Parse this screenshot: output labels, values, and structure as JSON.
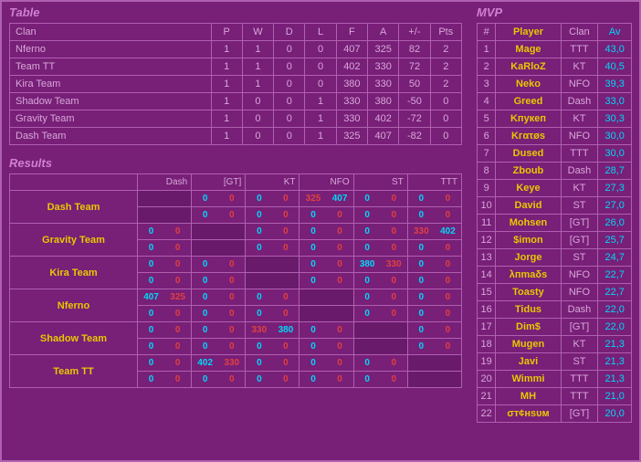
{
  "titles": {
    "table": "Table",
    "results": "Results",
    "mvp": "MVP"
  },
  "standings": {
    "headers": [
      "Clan",
      "P",
      "W",
      "D",
      "L",
      "F",
      "A",
      "+/-",
      "Pts"
    ],
    "rows": [
      {
        "clan": "Nferno",
        "p": 1,
        "w": 1,
        "d": 0,
        "l": 0,
        "f": 407,
        "a": 325,
        "diff": "82",
        "pts": 2
      },
      {
        "clan": "Team TT",
        "p": 1,
        "w": 1,
        "d": 0,
        "l": 0,
        "f": 402,
        "a": 330,
        "diff": "72",
        "pts": 2
      },
      {
        "clan": "Kira Team",
        "p": 1,
        "w": 1,
        "d": 0,
        "l": 0,
        "f": 380,
        "a": 330,
        "diff": "50",
        "pts": 2
      },
      {
        "clan": "Shadow Team",
        "p": 1,
        "w": 0,
        "d": 0,
        "l": 1,
        "f": 330,
        "a": 380,
        "diff": "-50",
        "pts": 0
      },
      {
        "clan": "Gravity Team",
        "p": 1,
        "w": 0,
        "d": 0,
        "l": 1,
        "f": 330,
        "a": 402,
        "diff": "-72",
        "pts": 0
      },
      {
        "clan": "Dash Team",
        "p": 1,
        "w": 0,
        "d": 0,
        "l": 1,
        "f": 325,
        "a": 407,
        "diff": "-82",
        "pts": 0
      }
    ]
  },
  "results": {
    "col_headers": [
      "Dash",
      "[GT]",
      "KT",
      "NFO",
      "ST",
      "TTT"
    ],
    "teams": [
      "Dash Team",
      "Gravity Team",
      "Kira Team",
      "Nferno",
      "Shadow Team",
      "Team TT"
    ],
    "matrix": [
      [
        null,
        [
          "0",
          "0"
        ],
        [
          "0",
          "0"
        ],
        [
          "325",
          "407"
        ],
        [
          "0",
          "0"
        ],
        [
          "0",
          "0"
        ]
      ],
      [
        [
          "0",
          "0"
        ],
        null,
        [
          "0",
          "0"
        ],
        [
          "0",
          "0"
        ],
        [
          "0",
          "0"
        ],
        [
          "330",
          "402"
        ]
      ],
      [
        [
          "0",
          "0"
        ],
        [
          "0",
          "0"
        ],
        null,
        [
          "0",
          "0"
        ],
        [
          "380",
          "330"
        ],
        [
          "0",
          "0"
        ]
      ],
      [
        [
          "407",
          "325"
        ],
        [
          "0",
          "0"
        ],
        [
          "0",
          "0"
        ],
        null,
        [
          "0",
          "0"
        ],
        [
          "0",
          "0"
        ]
      ],
      [
        [
          "0",
          "0"
        ],
        [
          "0",
          "0"
        ],
        [
          "330",
          "380"
        ],
        [
          "0",
          "0"
        ],
        null,
        [
          "0",
          "0"
        ]
      ],
      [
        [
          "0",
          "0"
        ],
        [
          "402",
          "330"
        ],
        [
          "0",
          "0"
        ],
        [
          "0",
          "0"
        ],
        [
          "0",
          "0"
        ],
        null
      ]
    ],
    "matrix2": [
      [
        null,
        [
          "0",
          "0"
        ],
        [
          "0",
          "0"
        ],
        [
          "0",
          "0"
        ],
        [
          "0",
          "0"
        ],
        [
          "0",
          "0"
        ]
      ],
      [
        [
          "0",
          "0"
        ],
        null,
        [
          "0",
          "0"
        ],
        [
          "0",
          "0"
        ],
        [
          "0",
          "0"
        ],
        [
          "0",
          "0"
        ]
      ],
      [
        [
          "0",
          "0"
        ],
        [
          "0",
          "0"
        ],
        null,
        [
          "0",
          "0"
        ],
        [
          "0",
          "0"
        ],
        [
          "0",
          "0"
        ]
      ],
      [
        [
          "0",
          "0"
        ],
        [
          "0",
          "0"
        ],
        [
          "0",
          "0"
        ],
        null,
        [
          "0",
          "0"
        ],
        [
          "0",
          "0"
        ]
      ],
      [
        [
          "0",
          "0"
        ],
        [
          "0",
          "0"
        ],
        [
          "0",
          "0"
        ],
        [
          "0",
          "0"
        ],
        null,
        [
          "0",
          "0"
        ]
      ],
      [
        [
          "0",
          "0"
        ],
        [
          "0",
          "0"
        ],
        [
          "0",
          "0"
        ],
        [
          "0",
          "0"
        ],
        [
          "0",
          "0"
        ],
        null
      ]
    ]
  },
  "mvp": {
    "headers": [
      "#",
      "Player",
      "Clan",
      "Av"
    ],
    "rows": [
      {
        "rank": 1,
        "player": "Mage",
        "clan": "TTT",
        "av": "43,0"
      },
      {
        "rank": 2,
        "player": "KaRloZ",
        "clan": "KT",
        "av": "40,5"
      },
      {
        "rank": 3,
        "player": "Neko",
        "clan": "NFO",
        "av": "39,3"
      },
      {
        "rank": 4,
        "player": "Greed",
        "clan": "Dash",
        "av": "33,0"
      },
      {
        "rank": 5,
        "player": "Kпукеп",
        "clan": "KT",
        "av": "30,3"
      },
      {
        "rank": 6,
        "player": "Kгατøs",
        "clan": "NFO",
        "av": "30,0"
      },
      {
        "rank": 7,
        "player": "Dused",
        "clan": "TTT",
        "av": "30,0"
      },
      {
        "rank": 8,
        "player": "Zboub",
        "clan": "Dash",
        "av": "28,7"
      },
      {
        "rank": 9,
        "player": "Keye",
        "clan": "KT",
        "av": "27,3"
      },
      {
        "rank": 10,
        "player": "David",
        "clan": "ST",
        "av": "27,0"
      },
      {
        "rank": 11,
        "player": "Mohsen",
        "clan": "[GT]",
        "av": "26,0"
      },
      {
        "rank": 12,
        "player": "$imon",
        "clan": "[GT]",
        "av": "25,7"
      },
      {
        "rank": 13,
        "player": "Jorge",
        "clan": "ST",
        "av": "24,7"
      },
      {
        "rank": 14,
        "player": "λпmaδs",
        "clan": "NFO",
        "av": "22,7"
      },
      {
        "rank": 15,
        "player": "Toasty",
        "clan": "NFO",
        "av": "22,7"
      },
      {
        "rank": 16,
        "player": "Tidus",
        "clan": "Dash",
        "av": "22,0"
      },
      {
        "rank": 17,
        "player": "Dim$",
        "clan": "[GT]",
        "av": "22,0"
      },
      {
        "rank": 18,
        "player": "Mugen",
        "clan": "KT",
        "av": "21,3"
      },
      {
        "rank": 19,
        "player": "Javi",
        "clan": "ST",
        "av": "21,3"
      },
      {
        "rank": 20,
        "player": "Wimmi",
        "clan": "TTT",
        "av": "21,3"
      },
      {
        "rank": 21,
        "player": "MH",
        "clan": "TTT",
        "av": "21,0"
      },
      {
        "rank": 22,
        "player": "σт¢нsυм",
        "clan": "[GT]",
        "av": "20,0"
      }
    ]
  }
}
